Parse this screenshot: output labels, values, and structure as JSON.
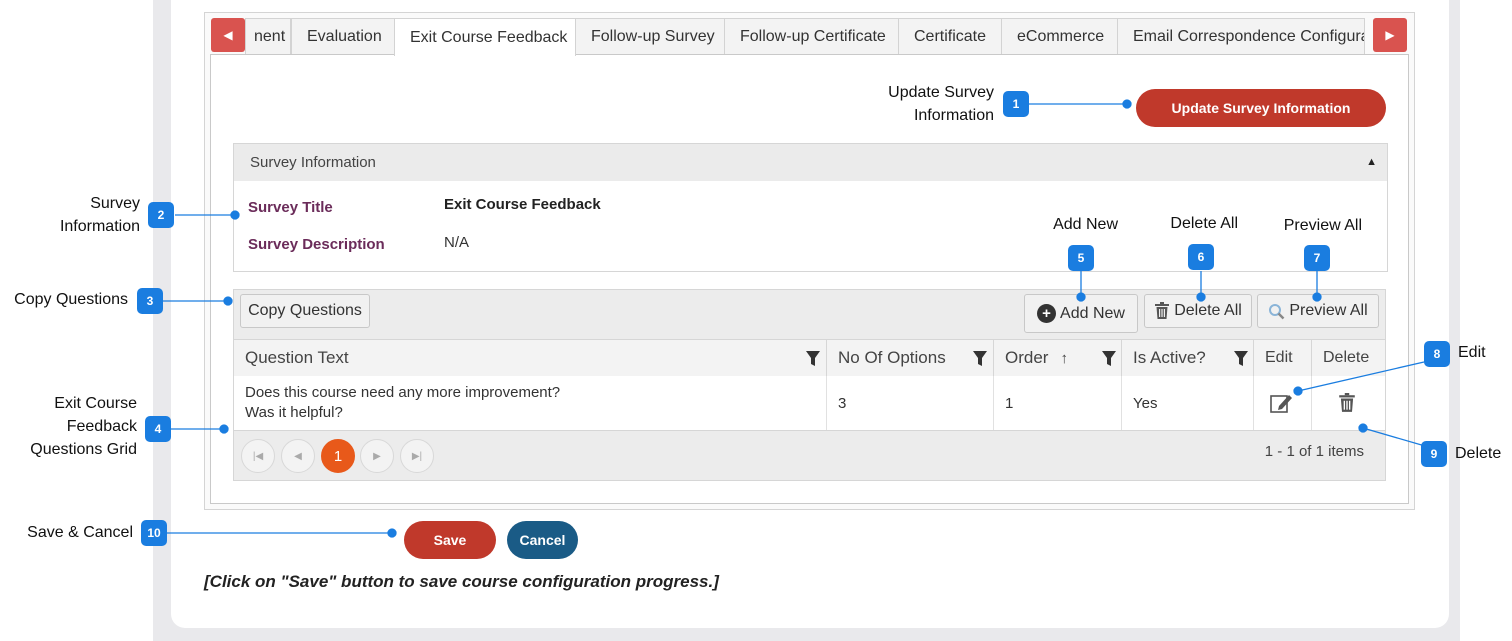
{
  "tabs": [
    "nent",
    "Evaluation",
    "Exit Course Feedback",
    "Follow-up Survey",
    "Follow-up Certificate",
    "Certificate",
    "eCommerce",
    "Email Correspondence Configurat"
  ],
  "update_button": "Update Survey Information",
  "panel": {
    "header": "Survey Information",
    "survey_title_label": "Survey Title",
    "survey_title_value": "Exit Course Feedback",
    "survey_desc_label": "Survey Description",
    "survey_desc_value": "N/A"
  },
  "toolbar": {
    "copy": "Copy Questions",
    "add": "Add New",
    "delete_all": "Delete All",
    "preview_all": "Preview All"
  },
  "grid": {
    "headers": {
      "question": "Question Text",
      "options": "No Of Options",
      "order": "Order",
      "active": "Is Active?",
      "edit": "Edit",
      "delete": "Delete"
    },
    "rows": [
      {
        "question_line1": "Does this course need any more improvement?",
        "question_line2": "Was it helpful?",
        "options": "3",
        "order": "1",
        "active": "Yes"
      }
    ],
    "pager_current": "1",
    "pager_info": "1 - 1 of 1 items"
  },
  "footer": {
    "save": "Save",
    "cancel": "Cancel",
    "note": "[Click on \"Save\" button to save course configuration progress.]"
  },
  "annotations": {
    "a1": "Update Survey Information",
    "a2": "Survey Information",
    "a3": "Copy Questions",
    "a4": "Exit Course Feedback Questions Grid",
    "a5": "Add New",
    "a6": "Delete All",
    "a7": "Preview All",
    "a8": "Edit",
    "a9": "Delete",
    "a10": "Save & Cancel",
    "badges": [
      "1",
      "2",
      "3",
      "4",
      "5",
      "6",
      "7",
      "8",
      "9",
      "10"
    ]
  },
  "colors": {
    "accent_red": "#c0392b",
    "cancel_blue": "#1a5b86",
    "badge_blue": "#1a7de0",
    "label_purple": "#6b2c5a",
    "pager_orange": "#e8591a"
  }
}
